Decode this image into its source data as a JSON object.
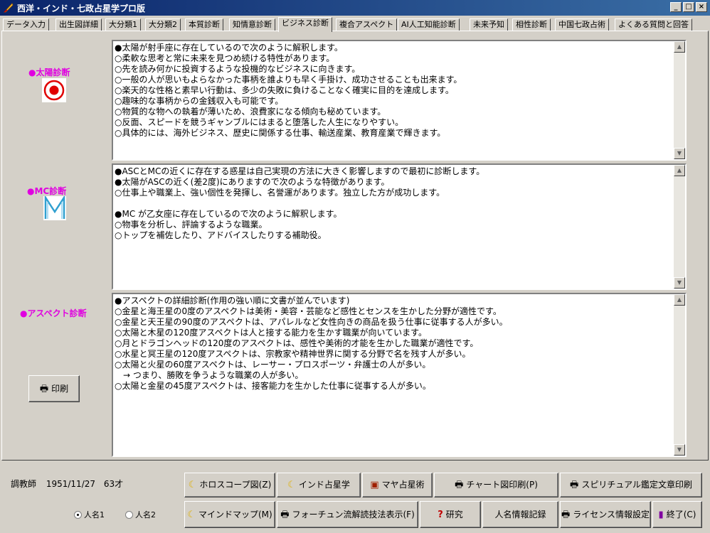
{
  "window": {
    "title": "西洋・インド・七政占星学プロ版",
    "min_label": "_",
    "max_label": "□",
    "close_label": "×"
  },
  "tabs": [
    {
      "label": "データ入力"
    },
    {
      "label": "出生図詳細"
    },
    {
      "label": "大分類1"
    },
    {
      "label": "大分類2"
    },
    {
      "label": "本質診断"
    },
    {
      "label": "知情意診断"
    },
    {
      "label": "ビジネス診断"
    },
    {
      "label": "複合アスペクト"
    },
    {
      "label": "AI人工知能診断"
    },
    {
      "label": "未来予知"
    },
    {
      "label": "相性診断"
    },
    {
      "label": "中国七政占術"
    },
    {
      "label": "よくある質問と回答"
    }
  ],
  "active_tab": "ビジネス診断",
  "sun": {
    "label": "●太陽診断",
    "lines": [
      "●太陽が射手座に存在しているので次のように解釈します。",
      "○柔軟な思考と常に未来を見つめ続ける特性があります。",
      "○先を読み何かに投資するような投機的なビジネスに向きます。",
      "○一般の人が思いもよらなかった事柄を誰よりも早く手掛け、成功させることも出来ます。",
      "○楽天的な性格と素早い行動は、多少の失敗に負けることなく確実に目的を達成します。",
      "○趣味的な事柄からの金銭収入も可能です。",
      "○物質的な物への執着が薄いため、浪費家になる傾向も秘めています。",
      "○反面、スピードを競うギャンブルにはまると堕落した人生になりやすい。",
      "○具体的には、海外ビジネス、歴史に関係する仕事、輸送産業、教育産業で輝きます。"
    ]
  },
  "mc": {
    "label": "●MC診断",
    "lines": [
      "●ASCとMCの近くに存在する惑星は自己実現の方法に大きく影響しますので最初に診断します。",
      "●太陽がASCの近く(差2度)にありますので次のような特徴があります。",
      "○仕事上や職業上、強い個性を発揮し、名誉運があります。独立した方が成功します。",
      "",
      "●MC が乙女座に存在しているので次のように解釈します。",
      "○物事を分析し、評論するような職業。",
      "○トップを補佐したり、アドバイスしたりする補助役。"
    ]
  },
  "aspect": {
    "label": "●アスペクト診断",
    "lines": [
      "●アスペクトの詳細診断(作用の強い順に文書が並んでいます)",
      "○金星と海王星の0度のアスペクトは美術・美容・芸能など感性とセンスを生かした分野が適性です。",
      "○金星と天王星の90度のアスペクトは、アパレルなど女性向きの商品を扱う仕事に従事する人が多い。",
      "○太陽と木星の120度アスペクトは人と接する能力を生かす職業が向いています。",
      "○月とドラゴンヘッドの120度のアスペクトは、感性や美術的才能を生かした職業が適性です。",
      "○水星と冥王星の120度アスペクトは、宗教家や精神世界に関する分野で名を残す人が多い。",
      "○太陽と火星の60度アスペクトは、レーサー・プロスポーツ・弁護士の人が多い。",
      "　→ つまり、勝敗を争うような職業の人が多い。",
      "○太陽と金星の45度アスペクトは、接客能力を生かした仕事に従事する人が多い。"
    ]
  },
  "print_button": "印刷",
  "status": {
    "name": "調教師",
    "birth": "1951/11/27",
    "age": "63才"
  },
  "radios": [
    {
      "label": "人名1",
      "checked": true
    },
    {
      "label": "人名2",
      "checked": false
    }
  ],
  "buttons": {
    "horoscope": "ホロスコープ図(Z)",
    "indian": "インド占星学",
    "maya": "マヤ占星術",
    "chart_print": "チャート図印刷(P)",
    "spiritual_print": "スピリチュアル鑑定文章印刷",
    "mindmap": "マインドマップ(M)",
    "fortune": "フォーチュン流解読技法表示(F)",
    "research": "研究",
    "name_record": "人名情報記録",
    "license": "ライセンス情報設定",
    "exit": "終了(C)"
  },
  "colors": {
    "label": "#e000e0",
    "title_start": "#0a246a",
    "title_end": "#3a6ea5",
    "face": "#d4d0c8"
  }
}
